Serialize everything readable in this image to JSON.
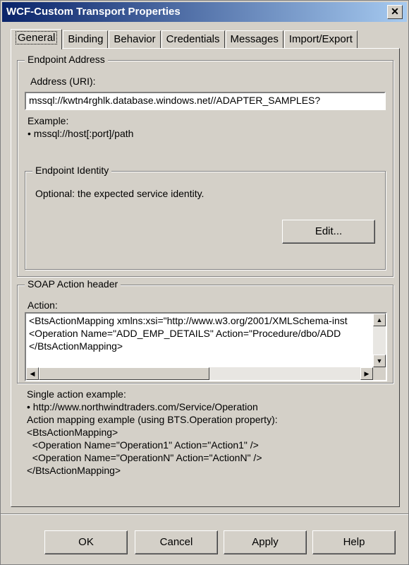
{
  "window": {
    "title": "WCF-Custom Transport Properties",
    "close_glyph": "✕"
  },
  "tabs": [
    {
      "label": "General",
      "active": true
    },
    {
      "label": "Binding"
    },
    {
      "label": "Behavior"
    },
    {
      "label": "Credentials"
    },
    {
      "label": "Messages"
    },
    {
      "label": "Import/Export"
    }
  ],
  "endpoint_address": {
    "group_label": "Endpoint Address",
    "address_label": "Address (URI):",
    "address_value": "mssql://kwtn4rghlk.database.windows.net//ADAPTER_SAMPLES?",
    "example_label": "Example:",
    "example_value": "• mssql://host[:port]/path"
  },
  "endpoint_identity": {
    "group_label": "Endpoint Identity",
    "description": "Optional: the expected service identity.",
    "edit_button": "Edit..."
  },
  "soap_action": {
    "group_label": "SOAP Action header",
    "action_label": "Action:",
    "action_lines": [
      "<BtsActionMapping xmlns:xsi=\"http://www.w3.org/2001/XMLSchema-inst",
      "  <Operation Name=\"ADD_EMP_DETAILS\" Action=\"Procedure/dbo/ADD",
      "</BtsActionMapping>"
    ],
    "help_lines": [
      "Single action example:",
      "• http://www.northwindtraders.com/Service/Operation",
      "Action mapping example (using BTS.Operation property):",
      "<BtsActionMapping>",
      "  <Operation Name=\"Operation1\" Action=\"Action1\" />",
      "  <Operation Name=\"OperationN\" Action=\"ActionN\" />",
      "</BtsActionMapping>"
    ]
  },
  "buttons": {
    "ok": "OK",
    "cancel": "Cancel",
    "apply": "Apply",
    "help": "Help"
  },
  "colors": {
    "dialog_bg": "#d4d0c8",
    "title_start": "#0a246a",
    "title_end": "#a6caf0"
  }
}
